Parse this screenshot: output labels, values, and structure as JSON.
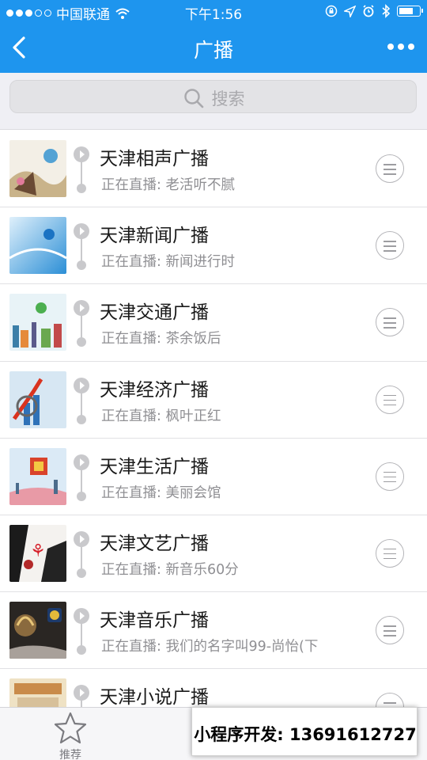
{
  "status_bar": {
    "carrier": "中国联通",
    "time": "下午1:56"
  },
  "nav": {
    "title": "广播"
  },
  "search": {
    "placeholder": "搜索"
  },
  "stations": [
    {
      "name": "天津相声广播",
      "live_prefix": "正在直播: ",
      "program": "老活听不腻"
    },
    {
      "name": "天津新闻广播",
      "live_prefix": "正在直播: ",
      "program": "新闻进行时"
    },
    {
      "name": "天津交通广播",
      "live_prefix": "正在直播: ",
      "program": "茶余饭后"
    },
    {
      "name": "天津经济广播",
      "live_prefix": "正在直播: ",
      "program": "枫叶正红"
    },
    {
      "name": "天津生活广播",
      "live_prefix": "正在直播: ",
      "program": "美丽会馆"
    },
    {
      "name": "天津文艺广播",
      "live_prefix": "正在直播: ",
      "program": "新音乐60分"
    },
    {
      "name": "天津音乐广播",
      "live_prefix": "正在直播: ",
      "program": "我们的名字叫99-尚怡(下"
    },
    {
      "name": "天津小说广播",
      "live_prefix": "",
      "program": ""
    }
  ],
  "tabbar": {
    "tabs": [
      {
        "label": "推荐"
      }
    ]
  },
  "watermark": {
    "text": "小程序开发: 13691612727"
  },
  "colors": {
    "brand": "#1e95ee",
    "background": "#efeff4"
  }
}
